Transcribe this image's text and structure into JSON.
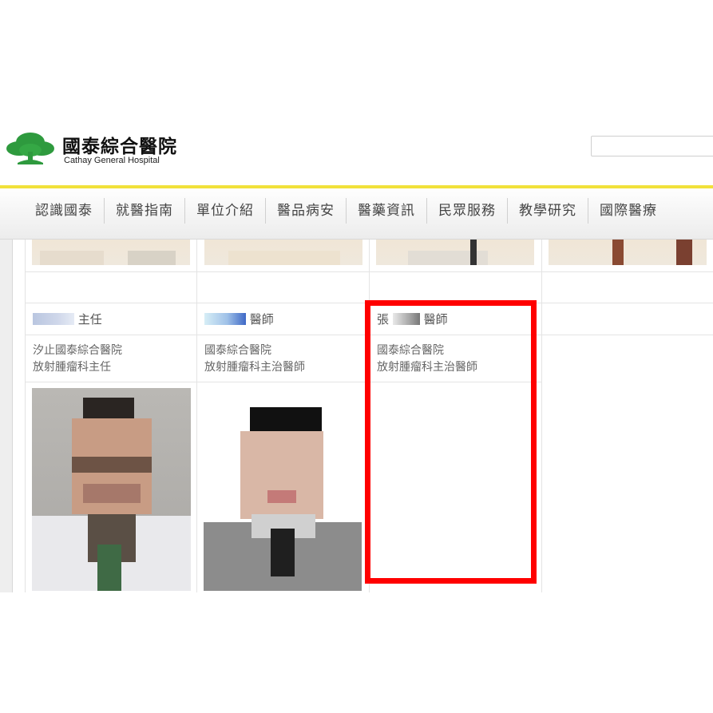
{
  "header": {
    "logo_zh": "國泰綜合醫院",
    "logo_en": "Cathay General Hospital",
    "search_placeholder": ""
  },
  "colors": {
    "accent_yellow": "#f1e13a",
    "logo_green": "#2e9a3e",
    "highlight_red": "#ff0000"
  },
  "nav": {
    "items": [
      "認識國泰",
      "就醫指南",
      "單位介紹",
      "醫品病安",
      "醫藥資訊",
      "民眾服務",
      "教學研究",
      "國際醫療"
    ]
  },
  "doctors": [
    {
      "name_suffix": "主任",
      "affiliation": "汐止國泰綜合醫院",
      "title": "放射腫瘤科主任"
    },
    {
      "name_suffix": "醫師",
      "affiliation": "國泰綜合醫院",
      "title": "放射腫瘤科主治醫師"
    },
    {
      "name_prefix": "張",
      "name_suffix": "醫師",
      "affiliation": "國泰綜合醫院",
      "title": "放射腫瘤科主治醫師"
    }
  ]
}
